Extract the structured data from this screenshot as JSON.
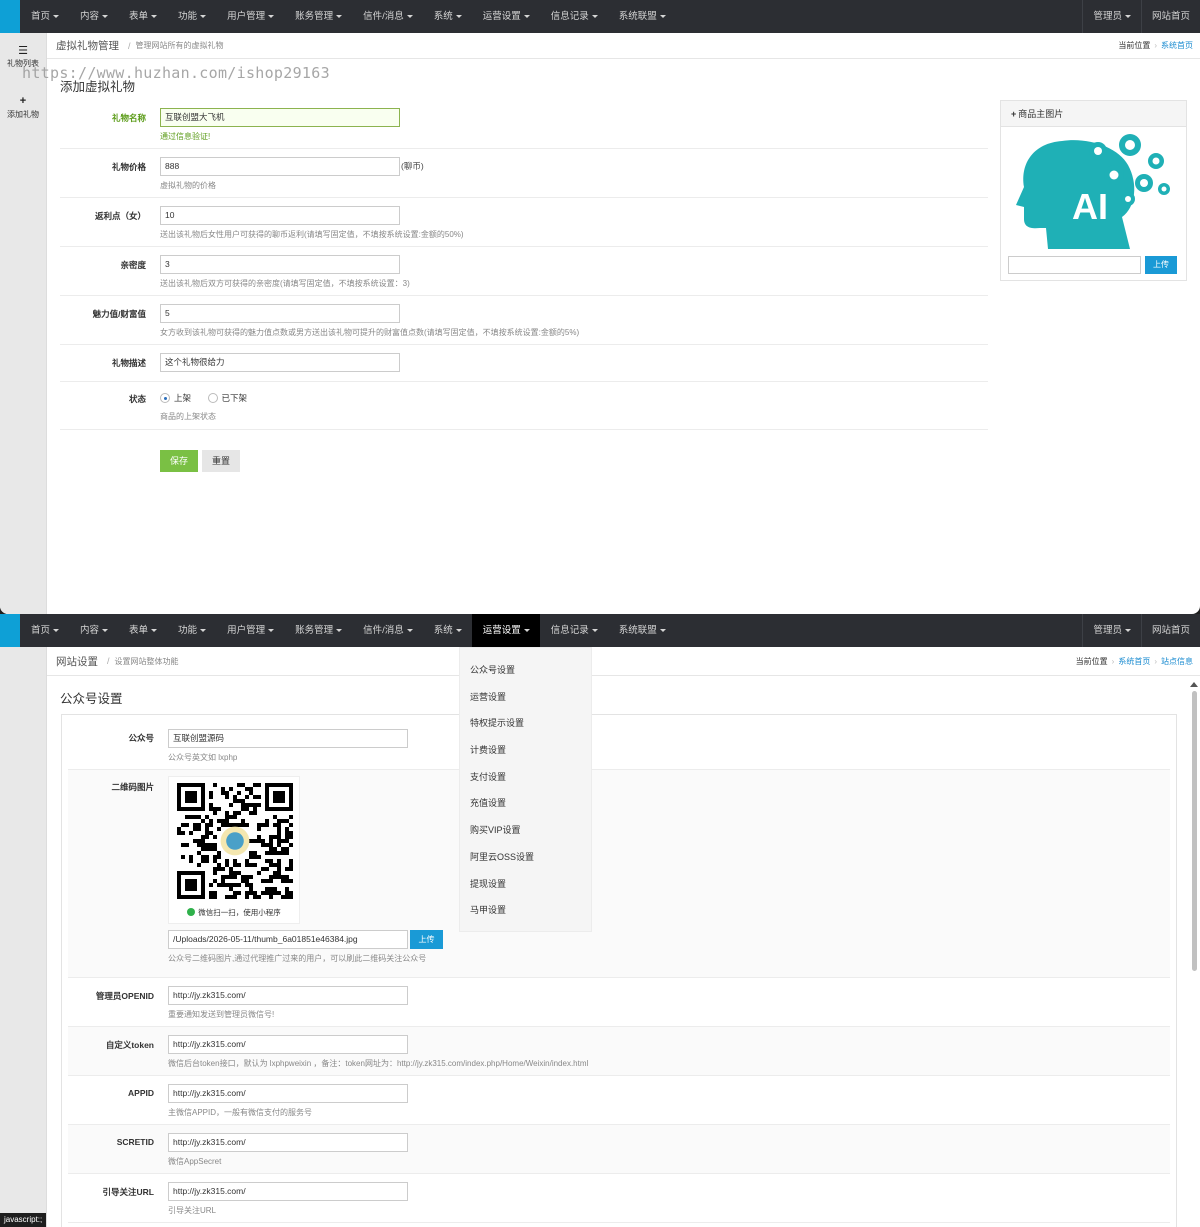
{
  "nav": {
    "items": [
      "首页",
      "内容",
      "表单",
      "功能",
      "用户管理",
      "账务管理",
      "信件/消息",
      "系统",
      "运营设置",
      "信息记录",
      "系统联盟"
    ],
    "right": [
      "管理员",
      "网站首页"
    ]
  },
  "screen1": {
    "sidebar": [
      {
        "icon": "list-icon",
        "label": "礼物列表"
      },
      {
        "icon": "plus-icon",
        "label": "添加礼物"
      }
    ],
    "breadcrumb": {
      "title": "虚拟礼物管理",
      "subtitle": "管理网站所有的虚拟礼物",
      "current": "当前位置",
      "link": "系统首页"
    },
    "watermark": "https://www.huzhan.com/ishop29163",
    "section_title": "添加虚拟礼物",
    "fields": {
      "name": {
        "label": "礼物名称",
        "value": "互联创盟大飞机",
        "help": "通过信息验证!"
      },
      "price": {
        "label": "礼物价格",
        "value": "888",
        "unit": "(聊币)",
        "help": "虚拟礼物的价格"
      },
      "rebate": {
        "label": "返利点（女）",
        "value": "10",
        "help": "送出该礼物后女性用户可获得的聊币返利(请填写固定值，不填按系统设置:金额的50%)"
      },
      "intimacy": {
        "label": "亲密度",
        "value": "3",
        "help": "送出该礼物后双方可获得的亲密度(请填写固定值，不填按系统设置：3)"
      },
      "charm": {
        "label": "魅力值/财富值",
        "value": "5",
        "help": "女方收到该礼物可获得的魅力值点数或男方送出该礼物可提升的财富值点数(请填写固定值，不填按系统设置:金额的5%)"
      },
      "desc": {
        "label": "礼物描述",
        "value": "这个礼物很给力"
      },
      "status": {
        "label": "状态",
        "options": [
          "上架",
          "已下架"
        ],
        "selected": "上架",
        "help": "商品的上架状态"
      }
    },
    "buttons": {
      "save": "保存",
      "reset": "重置"
    },
    "image_panel": {
      "title": "商品主图片",
      "image_text": "AI",
      "upload": "上传"
    }
  },
  "screen2": {
    "active_nav": "运营设置",
    "breadcrumb": {
      "title": "网站设置",
      "subtitle": "设置网站整体功能",
      "current": "当前位置",
      "links": [
        "系统首页",
        "站点信息"
      ]
    },
    "section_title": "公众号设置",
    "dropdown": [
      "公众号设置",
      "运营设置",
      "特权提示设置",
      "计费设置",
      "支付设置",
      "充值设置",
      "购买VIP设置",
      "阿里云OSS设置",
      "提现设置",
      "马甲设置"
    ],
    "fields": {
      "account": {
        "label": "公众号",
        "value": "互联创盟源码",
        "help": "公众号英文如 lxphp"
      },
      "qrcode": {
        "label": "二维码图片",
        "caption": "微信扫一扫，使用小程序",
        "path": "/Uploads/2026-05-11/thumb_6a01851e46384.jpg",
        "upload": "上传",
        "help": "公众号二维码图片,通过代理推广过来的用户，可以刷此二维码关注公众号"
      },
      "openid": {
        "label": "管理员OPENID",
        "value": "http://jy.zk315.com/",
        "help": "重要通知发送到管理员微信号!"
      },
      "token": {
        "label": "自定义token",
        "value": "http://jy.zk315.com/",
        "help": "微信后台token接口，默认为 lxphpweixin ，备注：token网址为：http://jy.zk315.com/index.php/Home/Weixin/index.html"
      },
      "appid": {
        "label": "APPID",
        "value": "http://jy.zk315.com/",
        "help": "主微信APPID，一般有微信支付的服务号"
      },
      "secret": {
        "label": "SCRETID",
        "value": "http://jy.zk315.com/",
        "help": "微信AppSecret"
      },
      "follow": {
        "label": "引导关注URL",
        "value": "http://jy.zk315.com/",
        "help": "引导关注URL"
      }
    },
    "statusbar": "javascript:;"
  }
}
